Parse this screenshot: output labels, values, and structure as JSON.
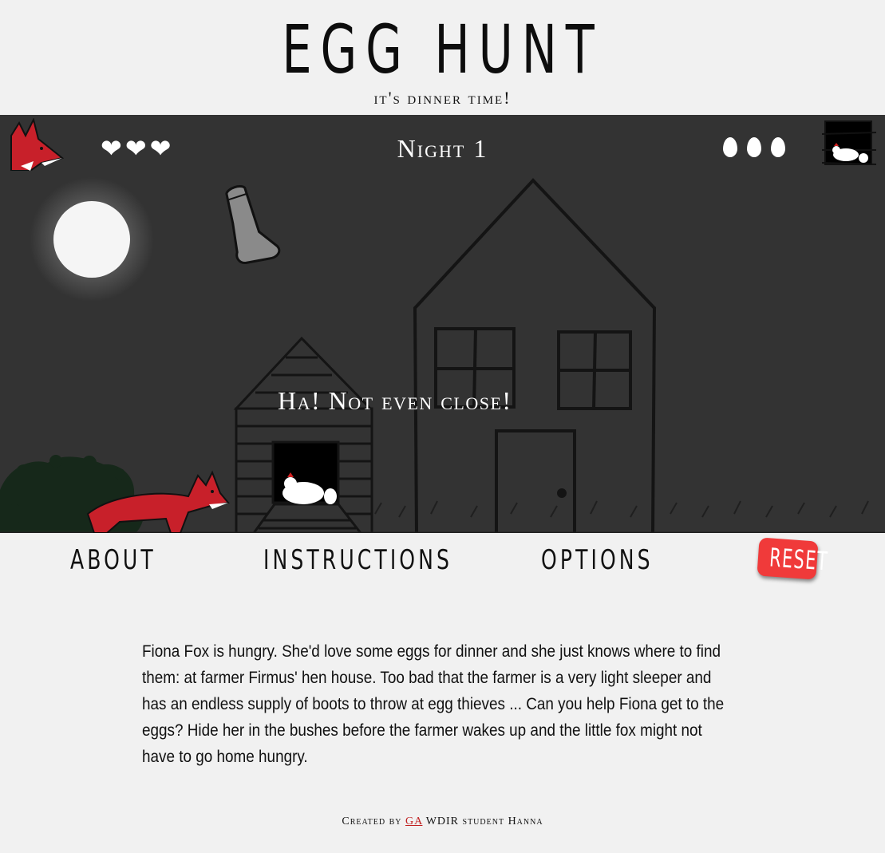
{
  "header": {
    "title": "EGG HUNT",
    "subtitle": "it's dinner time!"
  },
  "hud": {
    "lives": "❤❤❤",
    "lives_count": 3,
    "night_label": "Night 1",
    "eggs_remaining": 3
  },
  "game": {
    "message": "Ha! Not even close!"
  },
  "nav": {
    "about": "ABOUT",
    "instructions": "INSTRUCTIONS",
    "options": "OPTIONS",
    "reset": "RESET"
  },
  "description": "Fiona Fox is hungry. She'd love some eggs for dinner and she just knows where to find them: at farmer Firmus' hen house. Too bad that the farmer is a very light sleeper and has an endless supply of boots to throw at egg thieves ... Can you help Fiona get to the eggs? Hide her in the bushes before the farmer wakes up and the little fox might not have to go home hungry.",
  "footer": {
    "prefix": "Created by",
    "link": "GA",
    "suffix": "WDIR student Hanna"
  },
  "colors": {
    "background": "#f1f1f1",
    "game_background": "#333333",
    "fox_red": "#c8202a",
    "reset_button": "#f03a3a",
    "moon": "#f5f5f5"
  },
  "icons": {
    "fox": "fox-icon",
    "hen_house": "hen-house-icon",
    "heart": "heart-icon",
    "egg": "egg-icon"
  }
}
